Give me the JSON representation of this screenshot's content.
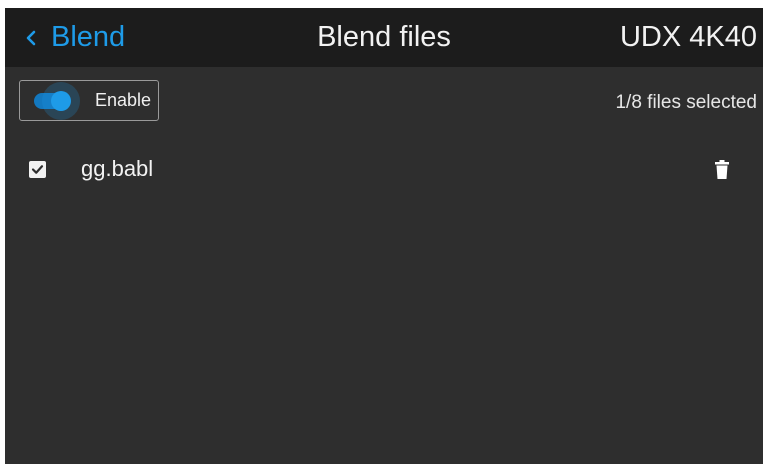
{
  "header": {
    "back_label": "Blend",
    "title": "Blend files",
    "device": "UDX 4K40"
  },
  "toolbar": {
    "enable_label": "Enable",
    "enabled": true,
    "selection_count": "1/8 files selected"
  },
  "files": [
    {
      "name": "gg.babl",
      "checked": true
    }
  ],
  "colors": {
    "accent": "#1e9be8",
    "header_bg": "#1c1c1c",
    "body_bg": "#2e2e2e"
  },
  "icons": {
    "back": "chevron-left-icon",
    "toggle": "toggle-switch-icon",
    "checkbox": "checkbox-checked-icon",
    "delete": "trash-icon"
  }
}
